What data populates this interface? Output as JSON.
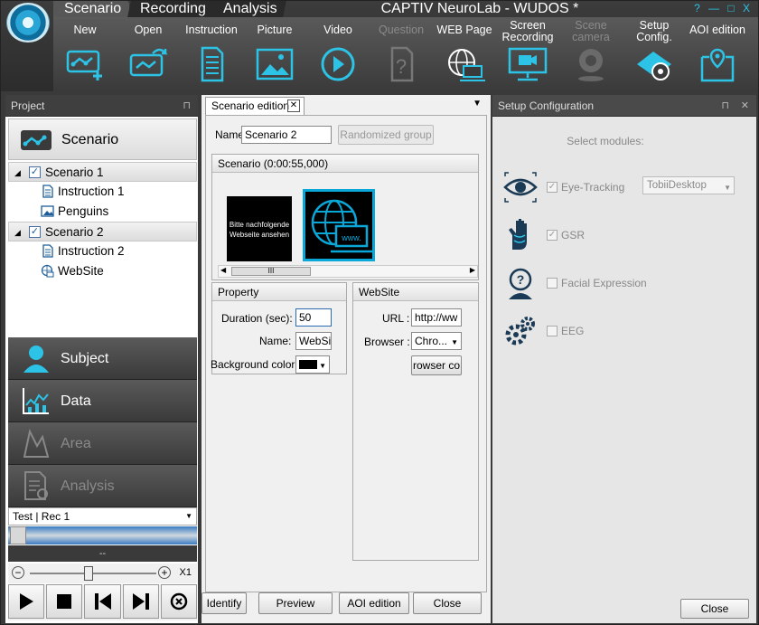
{
  "window": {
    "title": "CAPTIV NeuroLab - WUDOS *",
    "controls": "? — □ X",
    "tabs": [
      "Scenario",
      "Recording",
      "Analysis"
    ]
  },
  "toolbar": {
    "items": [
      {
        "label": "New",
        "icon": "new-scenario-icon",
        "enabled": true
      },
      {
        "label": "Open",
        "icon": "open-scenario-icon",
        "enabled": true
      },
      {
        "label": "Instruction",
        "icon": "instruction-icon",
        "enabled": true
      },
      {
        "label": "Picture",
        "icon": "picture-icon",
        "enabled": true
      },
      {
        "label": "Video",
        "icon": "video-icon",
        "enabled": true
      },
      {
        "label": "Question",
        "icon": "question-icon",
        "enabled": false
      },
      {
        "label": "WEB Page",
        "icon": "web-page-icon",
        "enabled": true
      },
      {
        "label": "Screen Recording",
        "icon": "screen-recording-icon",
        "enabled": true
      },
      {
        "label": "Scene camera",
        "icon": "scene-camera-icon",
        "enabled": false
      },
      {
        "label": "Setup Config.",
        "icon": "setup-config-icon",
        "enabled": true
      },
      {
        "label": "AOI edition",
        "icon": "aoi-edition-icon",
        "enabled": true
      }
    ]
  },
  "project": {
    "panel_title": "Project",
    "pin": "⊓",
    "nav_scenario": "Scenario",
    "tree": [
      {
        "label": "Scenario 1",
        "type": "group"
      },
      {
        "label": "Instruction 1",
        "type": "instruction"
      },
      {
        "label": "Penguins",
        "type": "picture"
      },
      {
        "label": "Scenario 2",
        "type": "group"
      },
      {
        "label": "Instruction 2",
        "type": "instruction"
      },
      {
        "label": "WebSite",
        "type": "web"
      }
    ],
    "nav": [
      "Subject",
      "Data",
      "Area",
      "Analysis"
    ],
    "recording_select": "Test | Rec 1",
    "time_label": "--",
    "zoom_label": "X1"
  },
  "editor": {
    "tab_label": "Scenario edition",
    "name_label": "Name",
    "name_value": "Scenario 2",
    "randomized_button": "Randomized group",
    "scenario_header": "Scenario (0:00:55,000)",
    "thumb1_text": "Bitte nachfolgende Webseite ansehen",
    "thumb2_text": "www.",
    "scroll_grip": "III",
    "property": {
      "header": "Property",
      "duration_label": "Duration (sec):",
      "duration_value": "50",
      "name_label": "Name:",
      "name_value": "WebSit",
      "bgcolor_label": "Background color:"
    },
    "website": {
      "header": "WebSite",
      "url_label": "URL :",
      "url_value": "http://ww",
      "browser_label": "Browser :",
      "browser_value": "Chro...",
      "browser_config_button": "rowser co"
    },
    "buttons": [
      "Identify",
      "Preview",
      "AOI edition",
      "Close"
    ]
  },
  "setup": {
    "panel_title": "Setup Configuration",
    "select_modules": "Select modules:",
    "modules": [
      {
        "label": "Eye-Tracking",
        "checked": true
      },
      {
        "label": "GSR",
        "checked": true
      },
      {
        "label": "Facial Expression",
        "checked": false
      },
      {
        "label": "EEG",
        "checked": false
      }
    ],
    "tracker_select": "TobiiDesktop",
    "close_button": "Close"
  },
  "colors": {
    "accent": "#2cc3e6",
    "dark": "#3a3a3a",
    "selected_border": "#0aa8d8"
  }
}
